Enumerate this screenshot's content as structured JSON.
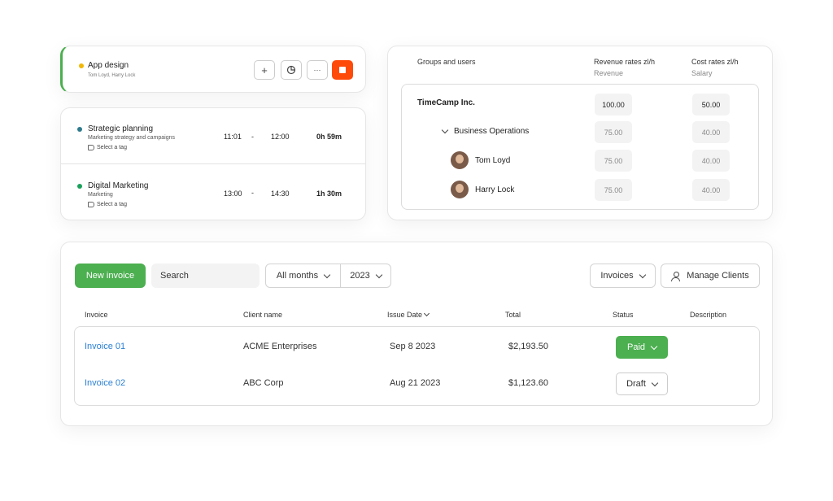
{
  "timer": {
    "title": "App design",
    "users": "Tom Loyd, Harry Lock",
    "add_icon": "+",
    "more_icon": "···"
  },
  "entries": [
    {
      "title": "Strategic planning",
      "subtitle": "Marketing strategy and campaigns",
      "tag": "Select a tag",
      "start": "11:01",
      "dash": "-",
      "end": "12:00",
      "duration": "0h 59m"
    },
    {
      "title": "Digital Marketing",
      "subtitle": "Marketing",
      "tag": "Select a tag",
      "start": "13:00",
      "dash": "-",
      "end": "14:30",
      "duration": "1h 30m"
    }
  ],
  "rates": {
    "header_groups": "Groups and users",
    "header_revenue": "Revenue rates zl/h",
    "header_revenue_sub": "Revenue",
    "header_cost": "Cost rates zl/h",
    "header_cost_sub": "Salary",
    "rows": [
      {
        "name": "TimeCamp Inc.",
        "revenue": "100.00",
        "cost": "50.00"
      },
      {
        "name": "Business Operations",
        "revenue": "75.00",
        "cost": "40.00"
      },
      {
        "name": "Tom Loyd",
        "revenue": "75.00",
        "cost": "40.00"
      },
      {
        "name": "Harry Lock",
        "revenue": "75.00",
        "cost": "40.00"
      }
    ]
  },
  "invoices": {
    "new_invoice_label": "New invoice",
    "search_placeholder": "Search",
    "months_label": "All months",
    "year_label": "2023",
    "invoices_label": "Invoices",
    "manage_clients_label": "Manage Clients",
    "columns": [
      "Invoice",
      "Client name",
      "Issue Date",
      "Total",
      "Status",
      "Description"
    ],
    "rows": [
      {
        "invoice": "Invoice 01",
        "client": "ACME Enterprises",
        "date": "Sep 8 2023",
        "total": "$2,193.50",
        "status": "Paid"
      },
      {
        "invoice": "Invoice 02",
        "client": "ABC Corp",
        "date": "Aug 21 2023",
        "total": "$1,123.60",
        "status": "Draft"
      }
    ]
  },
  "colors": {
    "accent_green": "#4caf50",
    "stop_orange": "#ff4b0a",
    "link_blue": "#2a7fd4"
  }
}
